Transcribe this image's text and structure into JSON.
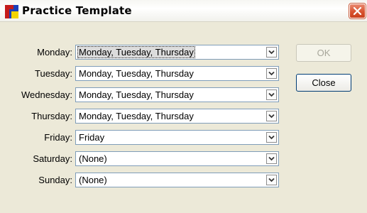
{
  "window": {
    "title": "Practice Template"
  },
  "rows": [
    {
      "label": "Monday:",
      "value": "Monday, Tuesday, Thursday"
    },
    {
      "label": "Tuesday:",
      "value": "Monday, Tuesday, Thursday"
    },
    {
      "label": "Wednesday:",
      "value": "Monday, Tuesday, Thursday"
    },
    {
      "label": "Thursday:",
      "value": "Monday, Tuesday, Thursday"
    },
    {
      "label": "Friday:",
      "value": "Friday"
    },
    {
      "label": "Saturday:",
      "value": "(None)"
    },
    {
      "label": "Sunday:",
      "value": "(None)"
    }
  ],
  "buttons": {
    "ok": "OK",
    "close": "Close"
  },
  "colors": {
    "close_button": "#d9532f",
    "window_bg": "#ece9d8",
    "combo_border": "#7f9db9"
  }
}
